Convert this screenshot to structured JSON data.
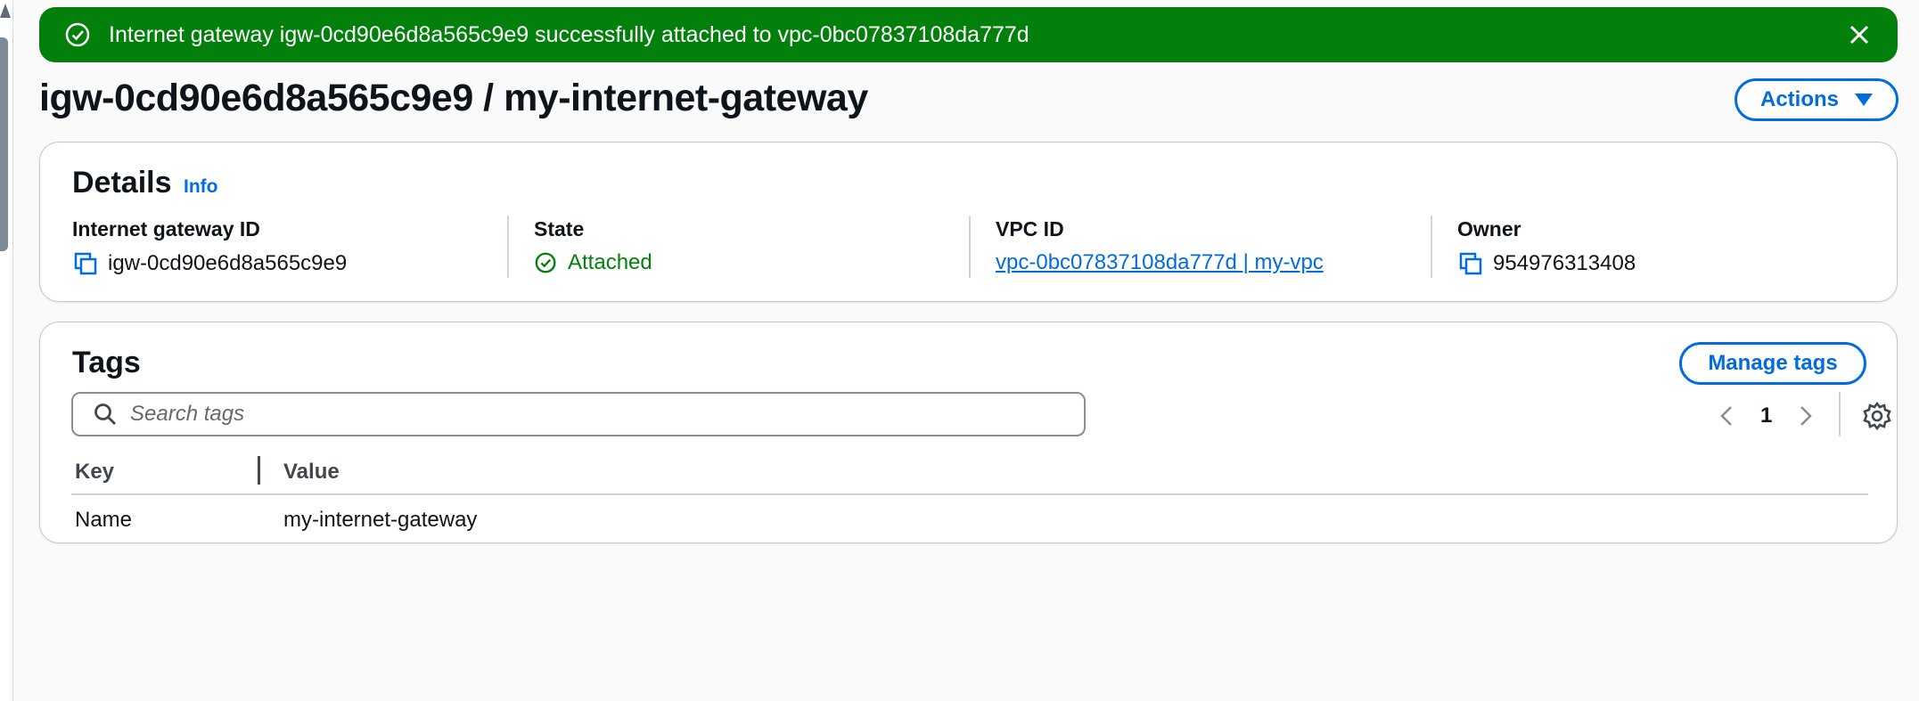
{
  "flash": {
    "message": "Internet gateway igw-0cd90e6d8a565c9e9 successfully attached to vpc-0bc07837108da777d",
    "type": "success",
    "color": "#037f0c",
    "icons": {
      "status": "check-circle-icon",
      "dismiss": "close-icon"
    }
  },
  "page": {
    "title": "igw-0cd90e6d8a565c9e9 / my-internet-gateway",
    "actions_label": "Actions"
  },
  "details": {
    "heading": "Details",
    "info_label": "Info",
    "fields": [
      {
        "label": "Internet gateway ID",
        "value": "igw-0cd90e6d8a565c9e9"
      },
      {
        "label": "State",
        "value": "Attached"
      },
      {
        "label": "VPC ID",
        "value": "vpc-0bc07837108da777d | my-vpc"
      },
      {
        "label": "Owner",
        "value": "954976313408"
      }
    ]
  },
  "tags": {
    "heading": "Tags",
    "manage_label": "Manage tags",
    "search_placeholder": "Search tags",
    "page_number": "1",
    "columns": [
      "Key",
      "Value"
    ],
    "rows": [
      {
        "key": "Name",
        "value": "my-internet-gateway"
      }
    ]
  },
  "colors": {
    "accent": "#006ce0",
    "success": "#037f0c",
    "text": "#0f141a",
    "background": "#fafafa"
  }
}
